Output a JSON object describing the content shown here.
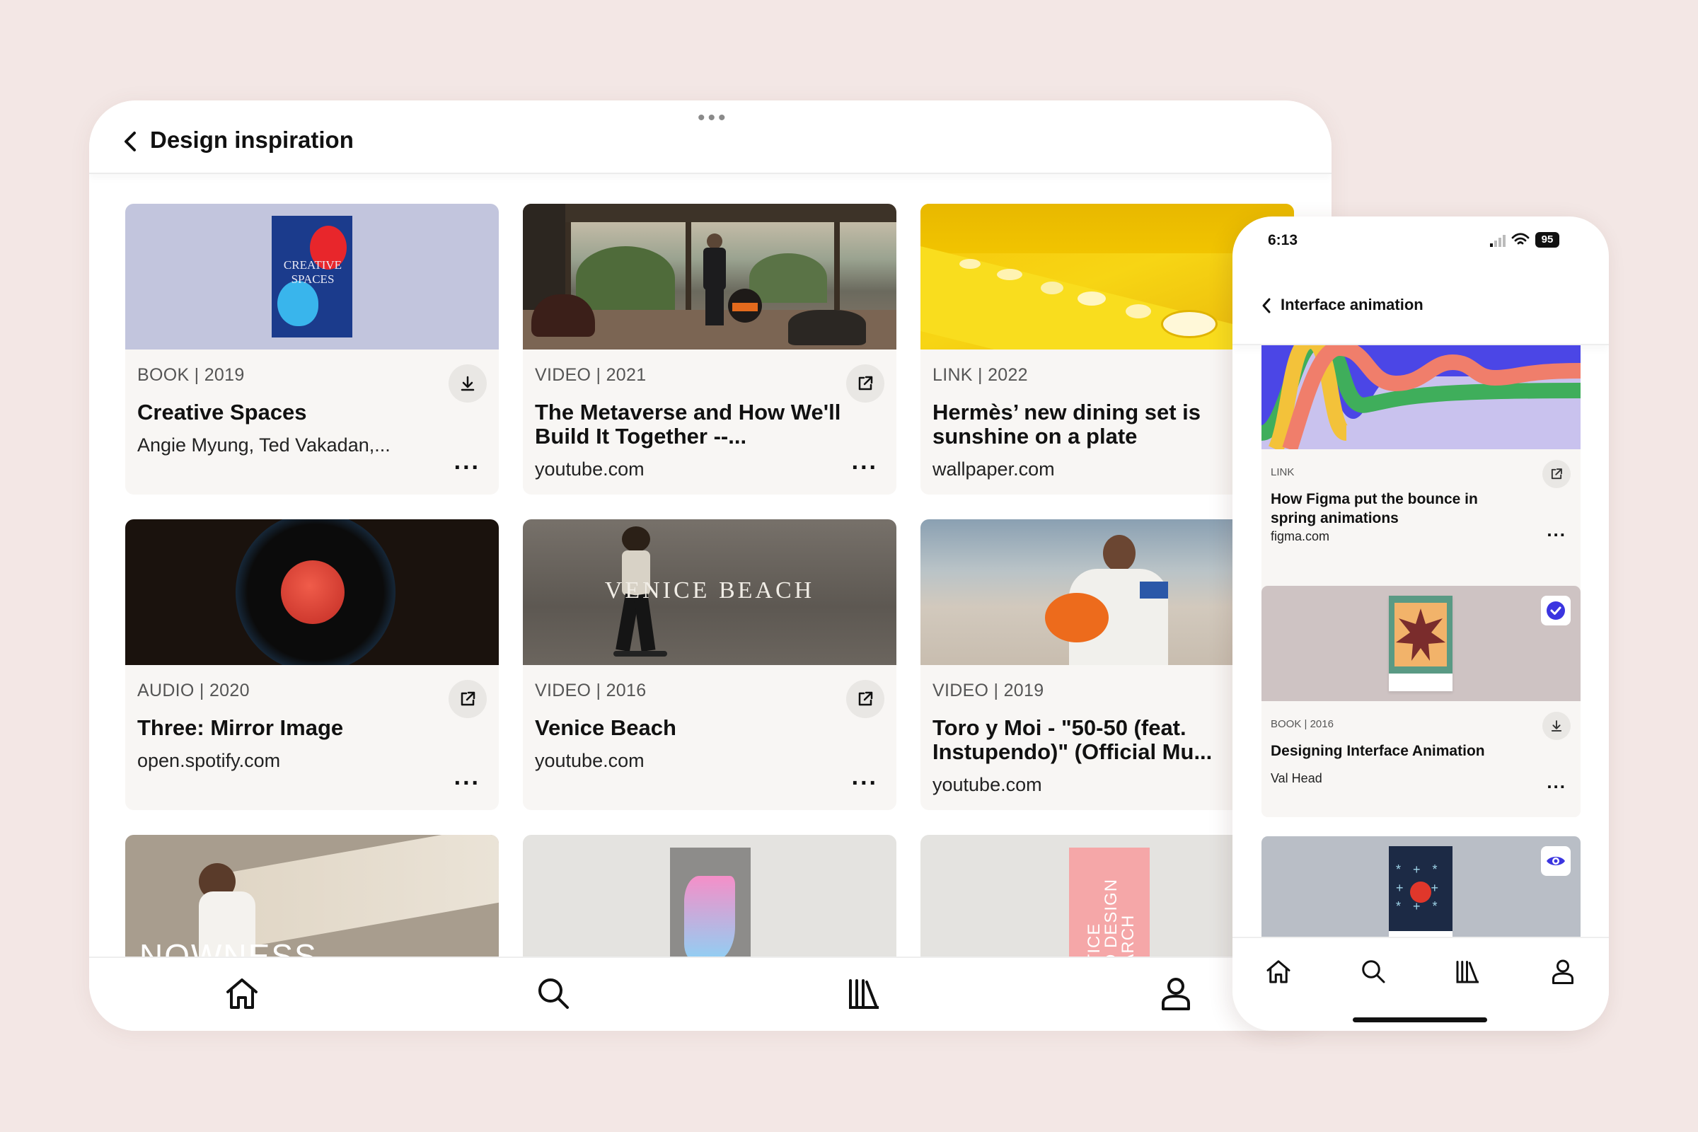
{
  "tablet": {
    "title": "Design inspiration",
    "cards": [
      {
        "meta": "BOOK | 2019",
        "title": "Creative Spaces",
        "subtitle": "Angie Myung, Ted Vakadan,...",
        "action_icon": "download-icon",
        "cover_text": "CREATIVE SPACES"
      },
      {
        "meta": "VIDEO | 2021",
        "title": "The Metaverse and How We'll Build It Together --...",
        "subtitle": "youtube.com",
        "action_icon": "external-link-icon"
      },
      {
        "meta": "LINK | 2022",
        "title": "Hermès’ new dining set is sunshine on a plate",
        "subtitle": "wallpaper.com",
        "action_icon": "external-link-icon"
      },
      {
        "meta": "AUDIO | 2020",
        "title": "Three: Mirror Image",
        "subtitle": "open.spotify.com",
        "action_icon": "external-link-icon"
      },
      {
        "meta": "VIDEO | 2016",
        "title": "Venice Beach",
        "subtitle": "youtube.com",
        "action_icon": "external-link-icon",
        "overlay_text": "VENICE BEACH"
      },
      {
        "meta": "VIDEO | 2019",
        "title": "Toro y Moi - \"50-50 (feat. Instupendo)\" (Official Mu...",
        "subtitle": "youtube.com",
        "action_icon": "external-link-icon"
      }
    ],
    "partial": {
      "nowness_text": "NOWNESS",
      "book_text": "PRACTICE BASED DESIGN RESEARCH"
    },
    "nav": [
      "home-icon",
      "search-icon",
      "library-icon",
      "profile-icon"
    ],
    "more_label": "..."
  },
  "phone": {
    "time": "6:13",
    "battery": "95",
    "title": "Interface animation",
    "cards": [
      {
        "meta": "LINK",
        "title": "How Figma put the bounce in spring animations",
        "subtitle": "figma.com",
        "action_icon": "external-link-icon"
      },
      {
        "meta": "BOOK | 2016",
        "title": "Designing Interface Animation",
        "subtitle": "Val Head",
        "action_icon": "download-icon",
        "badge": "check-icon"
      },
      {
        "badge": "eye-icon"
      }
    ],
    "more_label": "...",
    "nav": [
      "home-icon",
      "search-icon",
      "library-icon",
      "profile-icon"
    ]
  },
  "colors": {
    "background": "#f3e7e5",
    "card": "#f8f6f4",
    "accent": "#3b35e0"
  }
}
